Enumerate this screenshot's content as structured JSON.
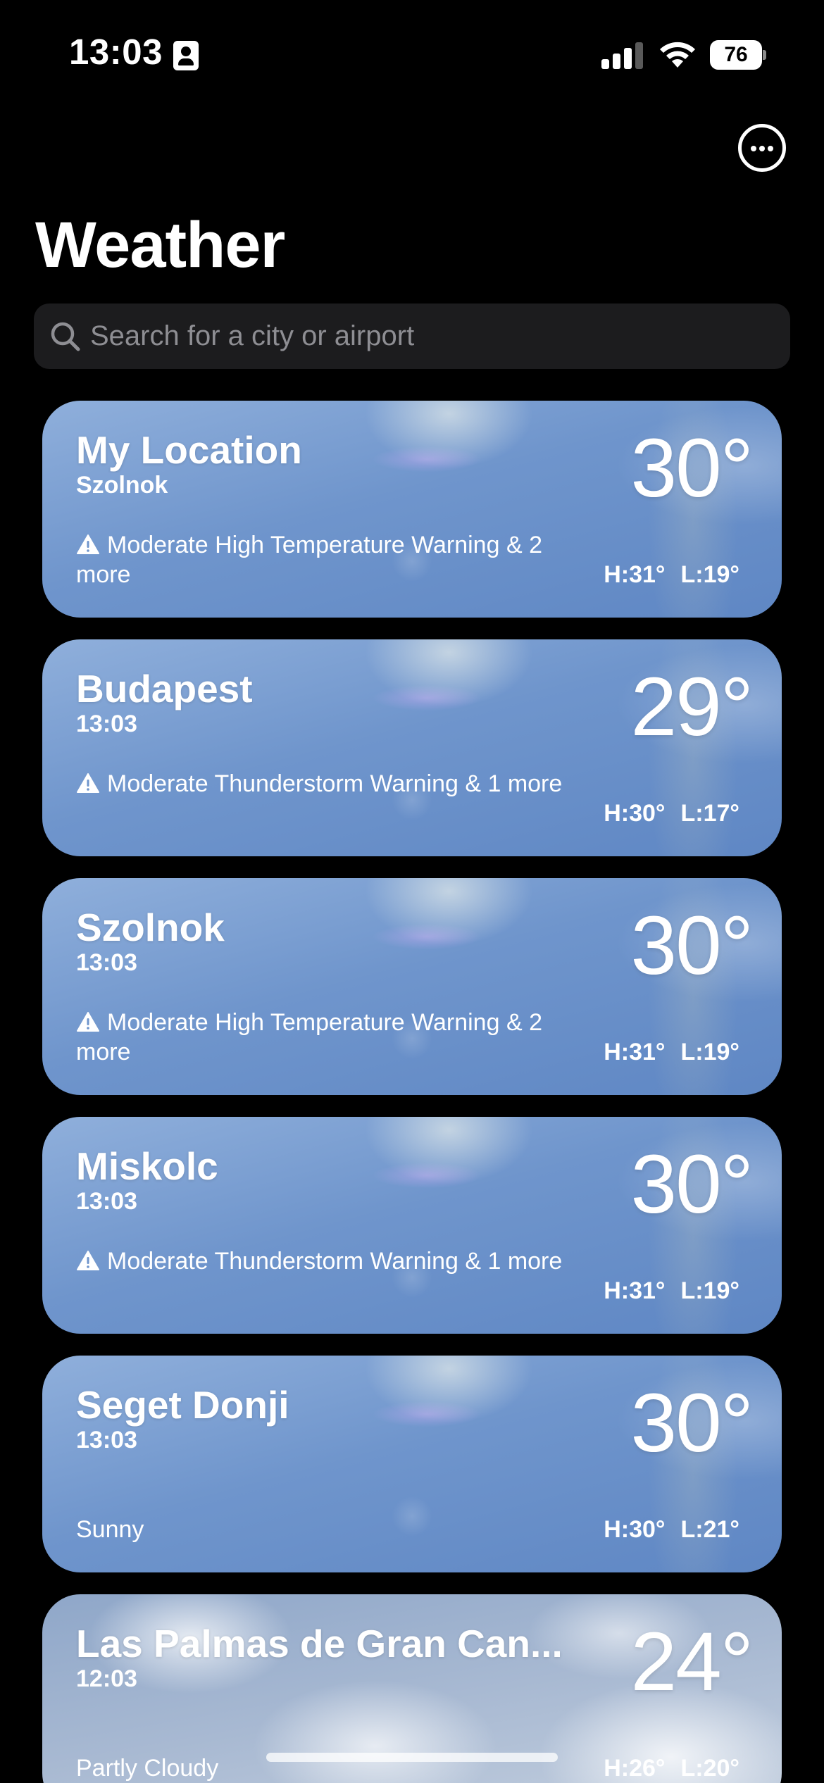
{
  "status_bar": {
    "time": "13:03",
    "battery": "76"
  },
  "header": {
    "title": "Weather"
  },
  "search": {
    "placeholder": "Search for a city or airport"
  },
  "cards": [
    {
      "name": "My Location",
      "subtitle": "Szolnok",
      "temp": "30°",
      "alert": "Moderate High Temperature Warning & 2 more",
      "high": "H:31°",
      "low": "L:19°",
      "condition": ""
    },
    {
      "name": "Budapest",
      "subtitle": "13:03",
      "temp": "29°",
      "alert": "Moderate Thunderstorm Warning & 1 more",
      "high": "H:30°",
      "low": "L:17°",
      "condition": ""
    },
    {
      "name": "Szolnok",
      "subtitle": "13:03",
      "temp": "30°",
      "alert": "Moderate High Temperature Warning & 2 more",
      "high": "H:31°",
      "low": "L:19°",
      "condition": ""
    },
    {
      "name": "Miskolc",
      "subtitle": "13:03",
      "temp": "30°",
      "alert": "Moderate Thunderstorm Warning & 1 more",
      "high": "H:31°",
      "low": "L:19°",
      "condition": ""
    },
    {
      "name": "Seget Donji",
      "subtitle": "13:03",
      "temp": "30°",
      "alert": "",
      "high": "H:30°",
      "low": "L:21°",
      "condition": "Sunny"
    },
    {
      "name": "Las Palmas de Gran Can...",
      "subtitle": "12:03",
      "temp": "24°",
      "alert": "",
      "high": "H:26°",
      "low": "L:20°",
      "condition": "Partly Cloudy"
    }
  ],
  "icons": {
    "more": "ellipsis-circle-icon",
    "search": "magnifier-icon",
    "alert": "warning-triangle-icon",
    "contact": "contact-card-icon",
    "signal": "cellular-signal-icon",
    "wifi": "wifi-icon",
    "battery": "battery-icon"
  }
}
